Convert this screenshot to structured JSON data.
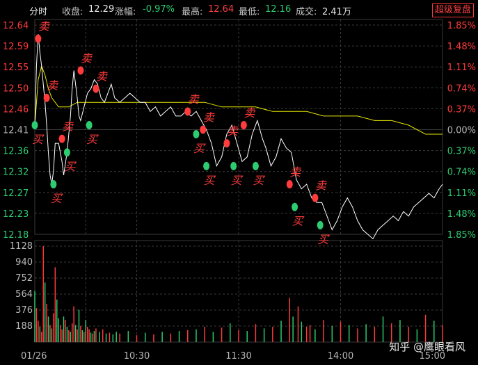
{
  "header": {
    "mode_label": "分时",
    "close_label": "收盘:",
    "close_value": "12.29",
    "change_label": "涨幅:",
    "change_value": "-0.97%",
    "high_label": "最高:",
    "high_value": "12.64",
    "low_label": "最低:",
    "low_value": "12.16",
    "volume_label": "成交:",
    "volume_value": "2.41万",
    "replay_button": "超级复盘"
  },
  "watermark": "知乎 @鹰眼看风",
  "colors": {
    "price_line": "#ffffff",
    "avg_line": "#e6e600",
    "up": "#ff3b3b",
    "down": "#2ecc71",
    "grid": "#3a3a3a",
    "axis_text": "#b8b8b8"
  },
  "chart_data": [
    {
      "type": "line",
      "title": "",
      "prev_close": 12.41,
      "ylim": [
        12.18,
        12.64
      ],
      "left_ticks": [
        "12.64",
        "12.59",
        "12.55",
        "12.50",
        "12.46",
        "12.41",
        "12.36",
        "12.32",
        "12.27",
        "12.23",
        "12.18"
      ],
      "right_ticks": [
        "1.85%",
        "1.48%",
        "1.11%",
        "0.74%",
        "0.37%",
        "0.00%",
        "0.37%",
        "0.74%",
        "1.11%",
        "1.48%",
        "1.85%"
      ],
      "x_ticks": [
        "01/26",
        "10:30",
        "11:30",
        "14:00",
        "15:00"
      ],
      "grid": true,
      "series": [
        {
          "kind": "price",
          "x": [
            0,
            1,
            2,
            3,
            4,
            5,
            6,
            7,
            8,
            9,
            10,
            11,
            12,
            14,
            16,
            17,
            19,
            21,
            22,
            23,
            25,
            26,
            27,
            29,
            31,
            33,
            35,
            37,
            39,
            41,
            43,
            45,
            47,
            50,
            53,
            56,
            59,
            62,
            65,
            68,
            71,
            74,
            77,
            80,
            83,
            86,
            89,
            92,
            95,
            98,
            101,
            104,
            107,
            110,
            113,
            116,
            119,
            122,
            125,
            128,
            131,
            134,
            136,
            139,
            142,
            145,
            148,
            151,
            154,
            157,
            160,
            163,
            166,
            169,
            172,
            175,
            178,
            181,
            184,
            187,
            190,
            193,
            196,
            199,
            202,
            205,
            208,
            211,
            214,
            217,
            220,
            223,
            226,
            229,
            232,
            235,
            238,
            240
          ],
          "y": [
            12.42,
            12.55,
            12.62,
            12.58,
            12.55,
            12.51,
            12.47,
            12.42,
            12.36,
            12.31,
            12.29,
            12.32,
            12.38,
            12.38,
            12.34,
            12.31,
            12.36,
            12.44,
            12.5,
            12.54,
            12.48,
            12.44,
            12.43,
            12.46,
            12.49,
            12.5,
            12.52,
            12.51,
            12.48,
            12.47,
            12.49,
            12.51,
            12.48,
            12.47,
            12.48,
            12.49,
            12.48,
            12.47,
            12.47,
            12.45,
            12.46,
            12.44,
            12.45,
            12.46,
            12.44,
            12.44,
            12.45,
            12.44,
            12.45,
            12.43,
            12.41,
            12.38,
            12.33,
            12.35,
            12.4,
            12.42,
            12.38,
            12.34,
            12.35,
            12.4,
            12.43,
            12.39,
            12.37,
            12.33,
            12.35,
            12.39,
            12.37,
            12.36,
            12.3,
            12.28,
            12.29,
            12.26,
            12.25,
            12.25,
            12.22,
            12.19,
            12.21,
            12.24,
            12.26,
            12.24,
            12.21,
            12.19,
            12.18,
            12.17,
            12.19,
            12.2,
            12.21,
            12.22,
            12.21,
            12.23,
            12.22,
            12.24,
            12.25,
            12.26,
            12.27,
            12.26,
            12.28,
            12.29
          ]
        },
        {
          "kind": "average",
          "x": [
            0,
            2,
            4,
            6,
            8,
            10,
            12,
            14,
            16,
            18,
            20,
            25,
            30,
            40,
            50,
            60,
            70,
            80,
            90,
            100,
            110,
            120,
            130,
            140,
            150,
            160,
            170,
            180,
            190,
            200,
            210,
            220,
            230,
            240
          ],
          "y": [
            12.42,
            12.52,
            12.55,
            12.53,
            12.5,
            12.48,
            12.47,
            12.46,
            12.46,
            12.46,
            12.46,
            12.47,
            12.47,
            12.47,
            12.47,
            12.47,
            12.47,
            12.47,
            12.47,
            12.47,
            12.46,
            12.46,
            12.46,
            12.45,
            12.45,
            12.45,
            12.44,
            12.44,
            12.44,
            12.43,
            12.43,
            12.42,
            12.4,
            12.4
          ]
        }
      ],
      "signals": [
        {
          "x": 2,
          "y": 12.61,
          "label": "卖",
          "kind": "sell"
        },
        {
          "x": 7,
          "y": 12.48,
          "label": "卖",
          "kind": "sell"
        },
        {
          "x": 16,
          "y": 12.39,
          "label": "卖",
          "kind": "sell"
        },
        {
          "x": 27,
          "y": 12.54,
          "label": "卖",
          "kind": "sell"
        },
        {
          "x": 36,
          "y": 12.5,
          "label": "卖",
          "kind": "sell"
        },
        {
          "x": 90,
          "y": 12.45,
          "label": "卖",
          "kind": "sell"
        },
        {
          "x": 99,
          "y": 12.41,
          "label": "卖",
          "kind": "sell"
        },
        {
          "x": 113,
          "y": 12.38,
          "label": "卖",
          "kind": "sell"
        },
        {
          "x": 123,
          "y": 12.42,
          "label": "卖",
          "kind": "sell"
        },
        {
          "x": 150,
          "y": 12.29,
          "label": "卖",
          "kind": "sell"
        },
        {
          "x": 165,
          "y": 12.26,
          "label": "卖",
          "kind": "sell"
        },
        {
          "x": 0,
          "y": 12.42,
          "label": "买",
          "kind": "buy"
        },
        {
          "x": 11,
          "y": 12.29,
          "label": "买",
          "kind": "buy"
        },
        {
          "x": 19,
          "y": 12.36,
          "label": "买",
          "kind": "buy"
        },
        {
          "x": 32,
          "y": 12.42,
          "label": "买",
          "kind": "buy"
        },
        {
          "x": 95,
          "y": 12.4,
          "label": "买",
          "kind": "buy"
        },
        {
          "x": 101,
          "y": 12.33,
          "label": "买",
          "kind": "buy"
        },
        {
          "x": 117,
          "y": 12.33,
          "label": "买",
          "kind": "buy"
        },
        {
          "x": 130,
          "y": 12.33,
          "label": "买",
          "kind": "buy"
        },
        {
          "x": 153,
          "y": 12.24,
          "label": "买",
          "kind": "buy"
        },
        {
          "x": 168,
          "y": 12.2,
          "label": "买",
          "kind": "buy"
        }
      ]
    },
    {
      "type": "bar",
      "title": "",
      "ylim": [
        0,
        1128
      ],
      "left_ticks": [
        "1128",
        "940",
        "752",
        "564",
        "376",
        "188"
      ],
      "x": [
        0,
        1,
        2,
        3,
        4,
        5,
        6,
        7,
        8,
        9,
        10,
        11,
        12,
        13,
        14,
        15,
        16,
        17,
        18,
        19,
        20,
        21,
        22,
        23,
        24,
        25,
        26,
        27,
        28,
        29,
        30,
        31,
        32,
        33,
        34,
        35,
        36,
        38,
        40,
        42,
        44,
        46,
        48,
        50,
        55,
        60,
        65,
        70,
        75,
        80,
        85,
        90,
        95,
        100,
        105,
        110,
        115,
        120,
        125,
        130,
        135,
        140,
        145,
        150,
        152,
        155,
        157,
        160,
        162,
        165,
        170,
        175,
        180,
        185,
        190,
        195,
        200,
        205,
        210,
        215,
        220,
        225,
        230,
        235,
        240
      ],
      "values": [
        600,
        400,
        250,
        180,
        120,
        1128,
        700,
        450,
        300,
        200,
        160,
        340,
        880,
        500,
        280,
        200,
        150,
        300,
        260,
        180,
        140,
        120,
        220,
        420,
        200,
        150,
        380,
        190,
        140,
        120,
        260,
        180,
        150,
        110,
        100,
        130,
        160,
        120,
        150,
        100,
        110,
        90,
        120,
        100,
        130,
        80,
        110,
        90,
        120,
        100,
        130,
        140,
        150,
        180,
        120,
        170,
        220,
        140,
        130,
        210,
        160,
        180,
        250,
        520,
        300,
        420,
        240,
        180,
        200,
        150,
        260,
        190,
        240,
        200,
        160,
        210,
        180,
        300,
        220,
        260,
        180,
        150,
        320,
        250,
        200
      ],
      "up": [
        0,
        1,
        1,
        0,
        1,
        1,
        0,
        1,
        0,
        1,
        0,
        1,
        1,
        0,
        0,
        1,
        1,
        0,
        1,
        0,
        1,
        0,
        1,
        1,
        0,
        1,
        0,
        1,
        0,
        1,
        0,
        1,
        1,
        0,
        1,
        0,
        1,
        0,
        1,
        0,
        1,
        0,
        0,
        1,
        0,
        1,
        0,
        1,
        0,
        1,
        0,
        1,
        0,
        1,
        0,
        1,
        0,
        1,
        0,
        1,
        0,
        1,
        0,
        1,
        0,
        1,
        0,
        1,
        1,
        0,
        1,
        0,
        1,
        0,
        1,
        0,
        1,
        0,
        1,
        0,
        1,
        0,
        1,
        0,
        1
      ]
    }
  ]
}
